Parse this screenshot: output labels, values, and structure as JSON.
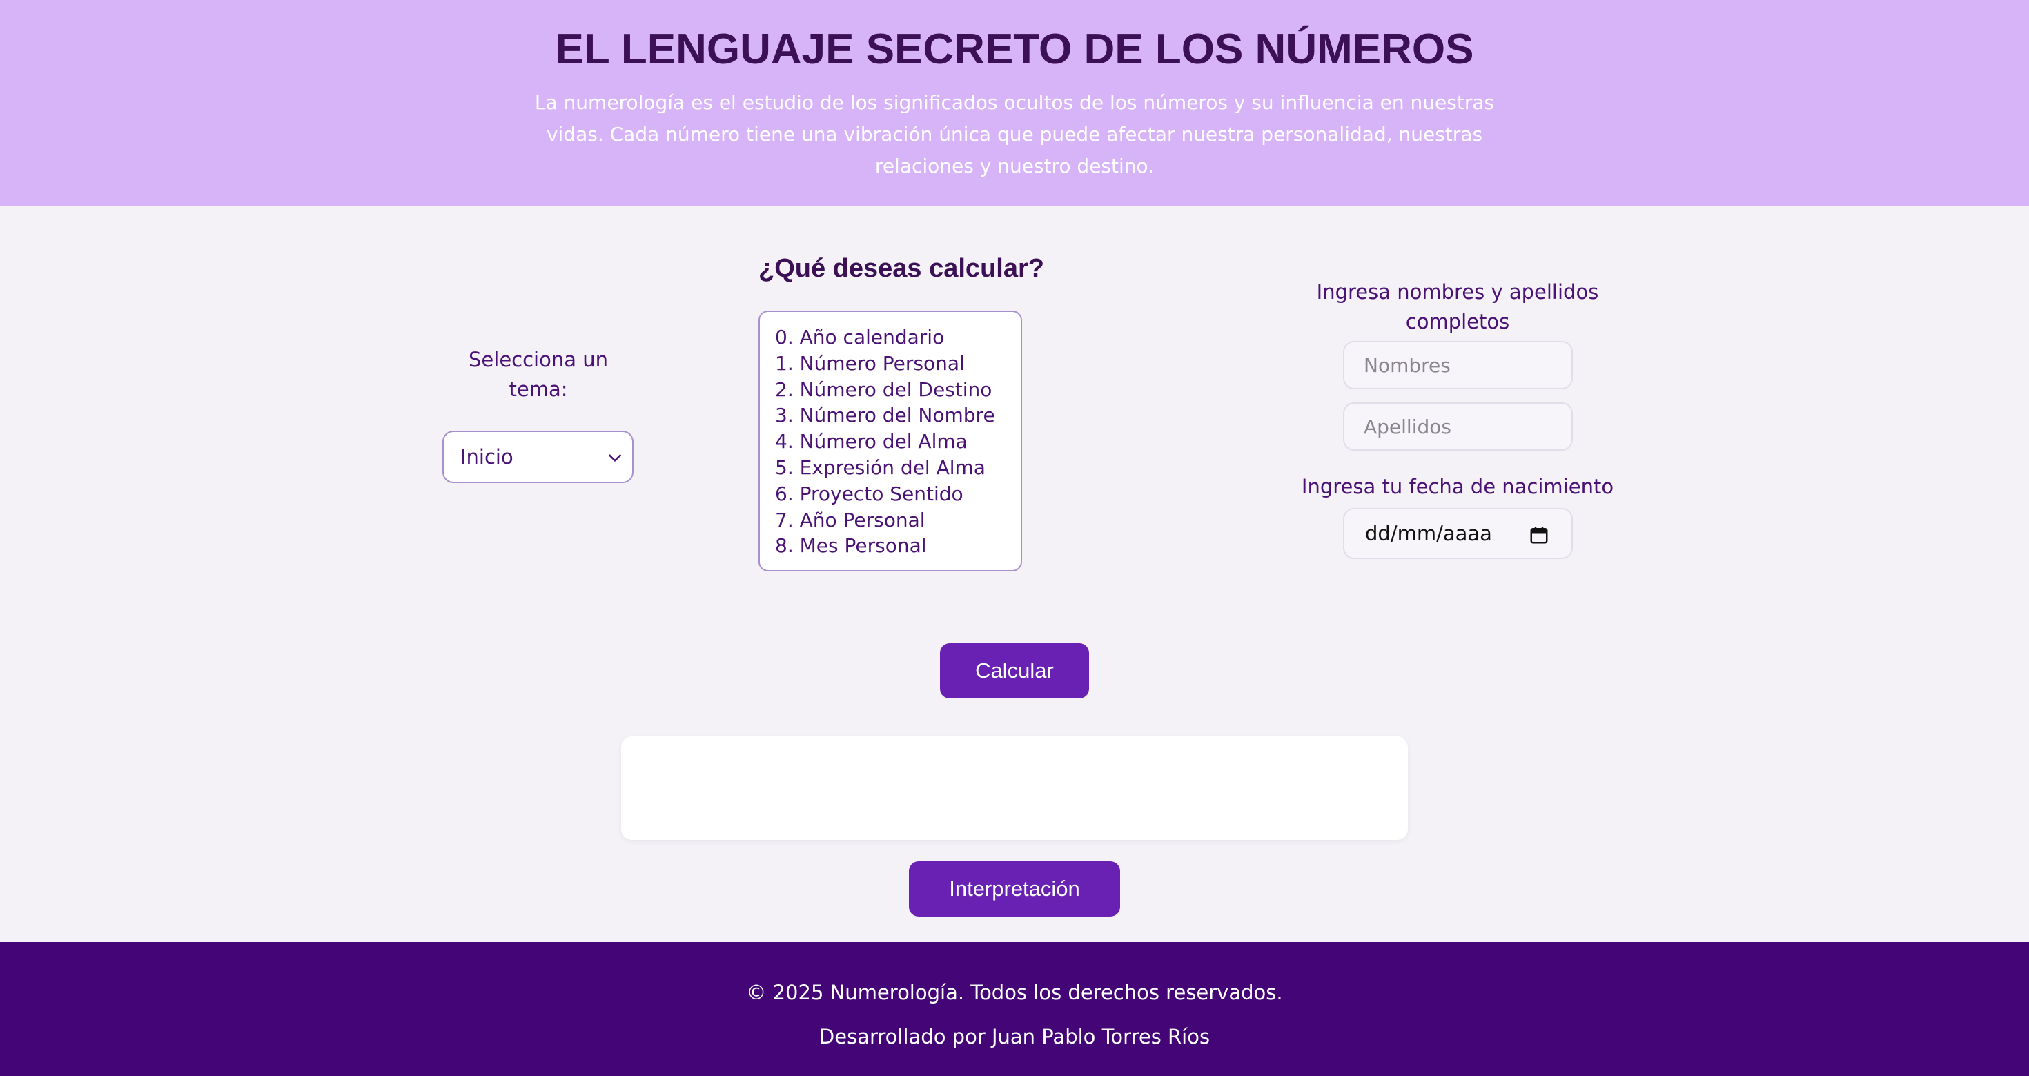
{
  "header": {
    "title": "EL LENGUAJE SECRETO DE LOS NÚMEROS",
    "intro": "La numerología es el estudio de los significados ocultos de los números y su influencia en nuestras vidas. Cada número tiene una vibración única que puede afectar nuestra personalidad, nuestras relaciones y nuestro destino."
  },
  "topic": {
    "label": "Selecciona un tema:",
    "selected": "Inicio"
  },
  "calc": {
    "title": "¿Qué deseas calcular?",
    "options": [
      "0. Año calendario",
      "1. Número Personal",
      "2. Número del Destino",
      "3. Número del Nombre",
      "4. Número del Alma",
      "5. Expresión del Alma",
      "6. Proyecto Sentido",
      "7. Año Personal",
      "8. Mes Personal"
    ]
  },
  "form": {
    "names_label": "Ingresa nombres y apellidos completos",
    "names_placeholder": "Nombres",
    "surnames_placeholder": "Apellidos",
    "date_label": "Ingresa tu fecha de nacimiento",
    "date_placeholder": "dd/mm/aaaa"
  },
  "buttons": {
    "calculate": "Calcular",
    "interpretation": "Interpretación"
  },
  "footer": {
    "copyright": "© 2025 Numerología. Todos los derechos reservados.",
    "developer": "Desarrollado por Juan Pablo Torres Ríos"
  },
  "colors": {
    "header_bg": "#d7b4f8",
    "title": "#3b1054",
    "accent": "#6821b3",
    "footer_bg": "#440677",
    "label": "#4a1275"
  },
  "icons": {
    "select": "chevron-down-icon",
    "date": "calendar-icon"
  }
}
